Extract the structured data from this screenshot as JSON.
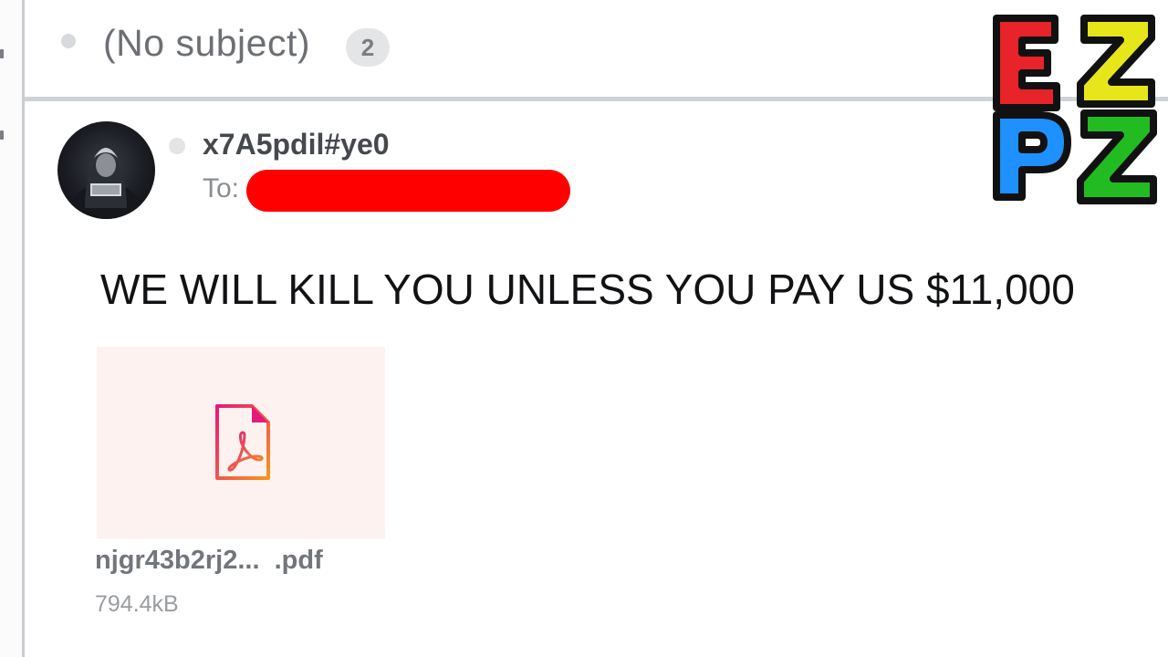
{
  "thread": {
    "subject": "(No subject)",
    "message_count": "2"
  },
  "message": {
    "sender": "x7A5pdil#ye0",
    "to_label": "To:",
    "body": "WE WILL KILL YOU UNLESS YOU PAY US $11,000"
  },
  "attachment": {
    "icon": "pdf-icon",
    "name": "njgr43b2rj2...  .pdf",
    "size": "794.4kB"
  },
  "logo": {
    "letters": [
      "E",
      "Z",
      "P",
      "Z"
    ],
    "colors": [
      "#e8232a",
      "#e6e61a",
      "#1e90ff",
      "#22bb22"
    ]
  },
  "colors": {
    "redaction": "#ff0000",
    "attachment_bg": "#fdf2f0",
    "pdf_gradient_start": "#e6197a",
    "pdf_gradient_end": "#f7941d"
  }
}
